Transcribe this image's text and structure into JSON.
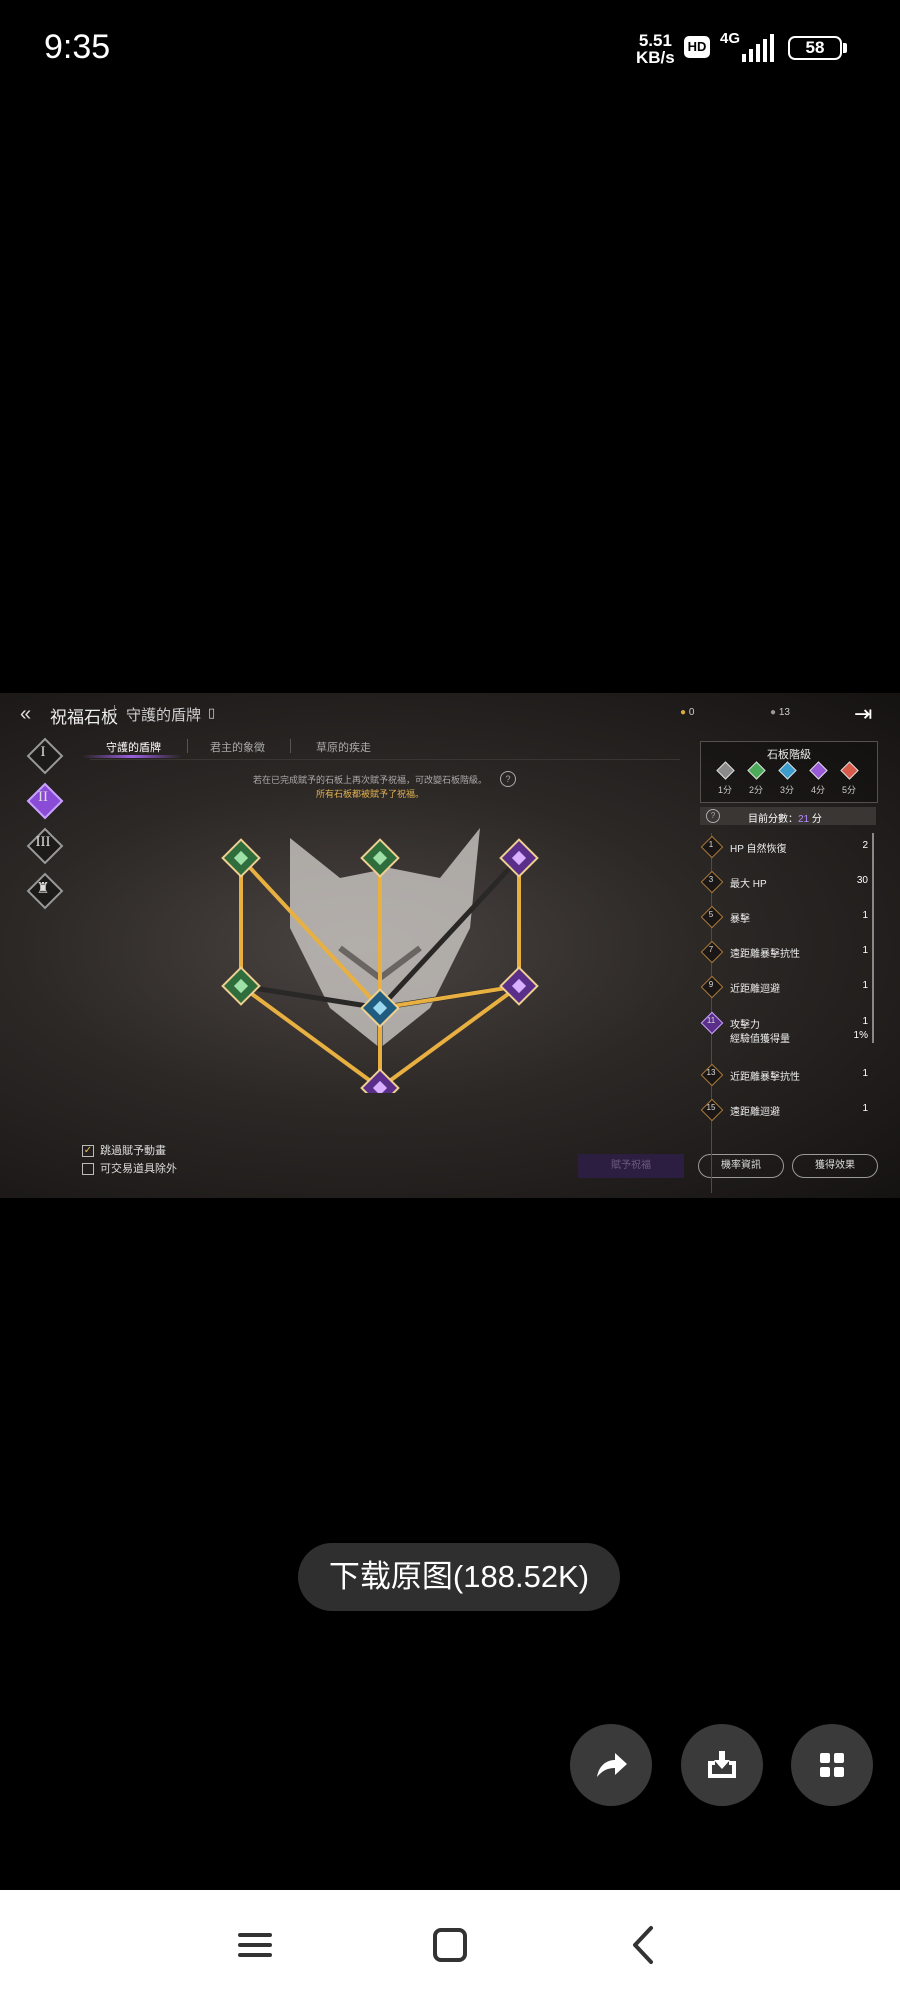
{
  "status_bar": {
    "time": "9:35",
    "net_speed_value": "5.51",
    "net_speed_unit": "KB/s",
    "hd": "HD",
    "network": "4G",
    "battery": "58"
  },
  "game": {
    "title": "祝福石板",
    "subtitle": "守護的盾牌",
    "currency_gold": "0",
    "currency_stone": "13",
    "roman_tabs": [
      "I",
      "II",
      "III",
      ""
    ],
    "tabs": [
      "守護的盾牌",
      "君主的象徵",
      "草原的疾走"
    ],
    "info_line1": "若在已完成賦予的石板上再次賦予祝福，可改變石板階級。",
    "info_line2": "所有石板都被賦予了祝福。",
    "help": "?",
    "options": {
      "skip_animation": "跳過賦予動畫",
      "exclude_tradeable": "可交易道具除外"
    },
    "grant_button": "賦予祝福",
    "prob_button": "機率資訊",
    "effects_button": "獲得效果",
    "panel": {
      "rank_title": "石板階級",
      "ranks": [
        {
          "label": "1分",
          "color": "#8a8a8a"
        },
        {
          "label": "2分",
          "color": "#4caa5a"
        },
        {
          "label": "3分",
          "color": "#3c9ccc"
        },
        {
          "label": "4分",
          "color": "#9a5ad8"
        },
        {
          "label": "5分",
          "color": "#d85a4a"
        }
      ],
      "score_label": "目前分數：",
      "score_value": "21",
      "score_unit": " 分",
      "stats": [
        {
          "level": "1",
          "name": "HP 自然恢復",
          "value": "2"
        },
        {
          "level": "3",
          "name": "最大 HP",
          "value": "30"
        },
        {
          "level": "5",
          "name": "暴擊",
          "value": "1"
        },
        {
          "level": "7",
          "name": "遠距離暴擊抗性",
          "value": "1"
        },
        {
          "level": "9",
          "name": "近距離迴避",
          "value": "1"
        },
        {
          "level": "11",
          "name": "攻擊力",
          "value": "1",
          "name2": "經驗值獲得量",
          "value2": "1%"
        },
        {
          "level": "13",
          "name": "近距離暴擊抗性",
          "value": "1"
        },
        {
          "level": "15",
          "name": "遠距離迴避",
          "value": "1"
        }
      ]
    }
  },
  "viewer": {
    "download_label": "下载原图(188.52K)"
  },
  "colors": {
    "accent_purple": "#9a5ad8",
    "gold_link": "#e0b050",
    "highlight_yellow": "#e8b040"
  }
}
